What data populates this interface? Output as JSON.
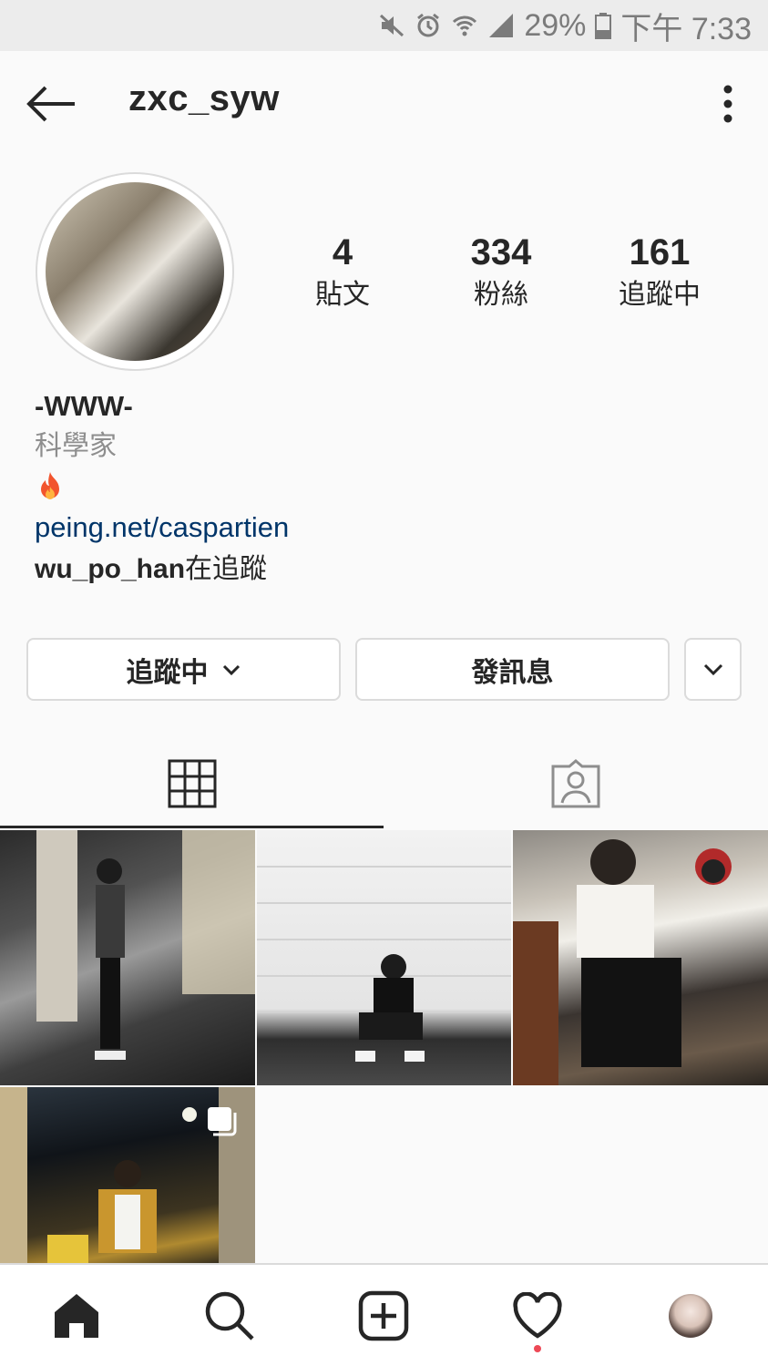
{
  "status_bar": {
    "battery": "29%",
    "time": "下午 7:33"
  },
  "header": {
    "username": "zxc_syw"
  },
  "stats": [
    {
      "value": "4",
      "label": "貼文"
    },
    {
      "value": "334",
      "label": "粉絲"
    },
    {
      "value": "161",
      "label": "追蹤中"
    }
  ],
  "bio": {
    "name": "-WWW-",
    "category": "科學家",
    "link": "peing.net/caspartien",
    "followed_by_user": "wu_po_han",
    "followed_by_suffix": "在追蹤"
  },
  "actions": {
    "following_label": "追蹤中",
    "message_label": "發訊息"
  },
  "icons": {
    "status": [
      "mute-icon",
      "alarm-icon",
      "wifi-icon",
      "signal-icon",
      "battery-icon"
    ],
    "nav": [
      "home-icon",
      "search-icon",
      "add-post-icon",
      "heart-icon",
      "profile-avatar"
    ]
  },
  "colors": {
    "link": "#003569",
    "notification_dot": "#ed4956"
  }
}
